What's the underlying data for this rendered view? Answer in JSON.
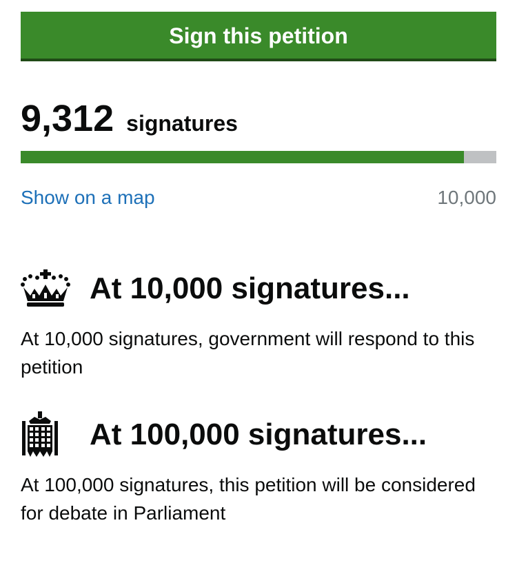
{
  "sign_button": {
    "label": "Sign this petition"
  },
  "signatures": {
    "count": "9,312",
    "label": "signatures",
    "progress_fraction": 0.9312,
    "target": "10,000"
  },
  "map_link": {
    "label": "Show on a map"
  },
  "thresholds": [
    {
      "icon": "crown-icon",
      "title": "At 10,000 signatures...",
      "description": "At 10,000 signatures, government will respond to this petition"
    },
    {
      "icon": "portcullis-icon",
      "title": "At 100,000 signatures...",
      "description": "At 100,000 signatures, this petition will be considered for debate in Parliament"
    }
  ],
  "colors": {
    "button_green": "#3a8a2a",
    "progress_green": "#3a8a2a",
    "progress_track": "#bfc1c3",
    "link_blue": "#1d70b8",
    "muted_grey": "#6f777b",
    "text": "#0b0c0c"
  }
}
